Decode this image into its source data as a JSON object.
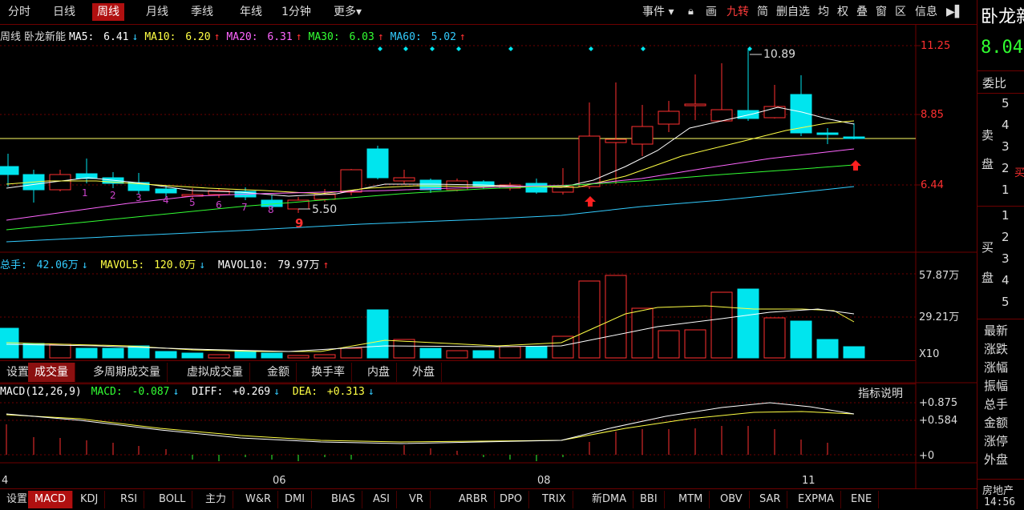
{
  "period_tabs": [
    {
      "label": "分时",
      "active": false
    },
    {
      "label": "日线",
      "active": false
    },
    {
      "label": "周线",
      "active": true
    },
    {
      "label": "月线",
      "active": false
    },
    {
      "label": "季线",
      "active": false
    },
    {
      "label": "年线",
      "active": false
    },
    {
      "label": "1分钟",
      "active": false
    },
    {
      "label": "更多▾",
      "active": false
    }
  ],
  "toolbar_right": {
    "event": "事件 ▾",
    "items": [
      "画",
      "九转",
      "简",
      "删自选",
      "均",
      "权",
      "叠",
      "窗",
      "区",
      "信息"
    ],
    "jiuzhuan_active": true
  },
  "stock": {
    "name": "卧龙新能",
    "side_name": "卧龙新",
    "price": "8.04"
  },
  "price_indicators": {
    "label": "周线",
    "name": "卧龙新能",
    "ma5": {
      "label": "MA5:",
      "value": "6.41",
      "arrow": "↓",
      "color": "#ffffff"
    },
    "ma10": {
      "label": "MA10:",
      "value": "6.20",
      "arrow": "↑",
      "color": "#ffff44"
    },
    "ma20": {
      "label": "MA20:",
      "value": "6.31",
      "arrow": "↑",
      "color": "#ff66ff"
    },
    "ma30": {
      "label": "MA30:",
      "value": "6.03",
      "arrow": "↑",
      "color": "#33ff33"
    },
    "ma60": {
      "label": "MA60:",
      "value": "5.02",
      "arrow": "↑",
      "color": "#33ccff"
    }
  },
  "price_axis": [
    "11.25",
    "8.85",
    "6.44"
  ],
  "price_annotations": {
    "high": "10.89",
    "low": "5.50",
    "seq_numbers": [
      "1",
      "2",
      "3",
      "4",
      "5",
      "6",
      "7",
      "8",
      "9"
    ]
  },
  "volume_indicators": {
    "total": {
      "label": "总手:",
      "value": "42.06万",
      "arrow": "↓"
    },
    "mavol5": {
      "label": "MAVOL5:",
      "value": "120.0万",
      "arrow": "↓"
    },
    "mavol10": {
      "label": "MAVOL10:",
      "value": "79.97万",
      "arrow": "↑"
    }
  },
  "volume_axis": [
    "57.87万",
    "29.21万",
    "X10"
  ],
  "volume_tabs": [
    {
      "label": "设置",
      "active": false
    },
    {
      "label": "成交量",
      "active": true
    },
    {
      "label": "多周期成交量",
      "active": false
    },
    {
      "label": "虚拟成交量",
      "active": false
    },
    {
      "label": "金额",
      "active": false
    },
    {
      "label": "换手率",
      "active": false
    },
    {
      "label": "内盘",
      "active": false
    },
    {
      "label": "外盘",
      "active": false
    }
  ],
  "macd": {
    "label": "MACD(12,26,9)",
    "macd": {
      "label": "MACD:",
      "value": "-0.087",
      "arrow": "↓"
    },
    "diff": {
      "label": "DIFF:",
      "value": "+0.269",
      "arrow": "↓"
    },
    "dea": {
      "label": "DEA:",
      "value": "+0.313",
      "arrow": "↓"
    },
    "help": "指标说明",
    "axis": [
      "+0.875",
      "+0.584",
      "+0"
    ]
  },
  "x_axis": [
    "4",
    "06",
    "08",
    "11"
  ],
  "bottom_tabs": [
    {
      "label": "设置",
      "active": false
    },
    {
      "label": "MACD",
      "active": true
    },
    {
      "label": "KDJ",
      "active": false
    },
    {
      "label": "RSI",
      "active": false
    },
    {
      "label": "BOLL",
      "active": false
    },
    {
      "label": "主力",
      "active": false
    },
    {
      "label": "W&R",
      "active": false
    },
    {
      "label": "DMI",
      "active": false
    },
    {
      "label": "BIAS",
      "active": false
    },
    {
      "label": "ASI",
      "active": false
    },
    {
      "label": "VR",
      "active": false
    },
    {
      "label": "ARBR",
      "active": false
    },
    {
      "label": "DPO",
      "active": false
    },
    {
      "label": "TRIX",
      "active": false
    },
    {
      "label": "新DMA",
      "active": false
    },
    {
      "label": "BBI",
      "active": false
    },
    {
      "label": "MTM",
      "active": false
    },
    {
      "label": "OBV",
      "active": false
    },
    {
      "label": "SAR",
      "active": false
    },
    {
      "label": "EXPMA",
      "active": false
    },
    {
      "label": "ENE",
      "active": false
    }
  ],
  "side_panel": {
    "weibi": "委比",
    "sell_label": [
      "卖",
      "盘"
    ],
    "sell_levels": [
      "5",
      "4",
      "3",
      "2",
      "1"
    ],
    "buy_label": [
      "买",
      "盘"
    ],
    "buy_levels": [
      "1",
      "2",
      "3",
      "4",
      "5"
    ],
    "buy_tag": "买",
    "fields": [
      "最新",
      "涨跌",
      "涨幅",
      "振幅",
      "总手",
      "金额",
      "涨停",
      "外盘"
    ],
    "sector": "房地产",
    "time": "14:56"
  },
  "colors": {
    "up": "#ff3030",
    "down": "#00e5ee",
    "grid": "#6e0000",
    "text": "#dddddd"
  }
}
